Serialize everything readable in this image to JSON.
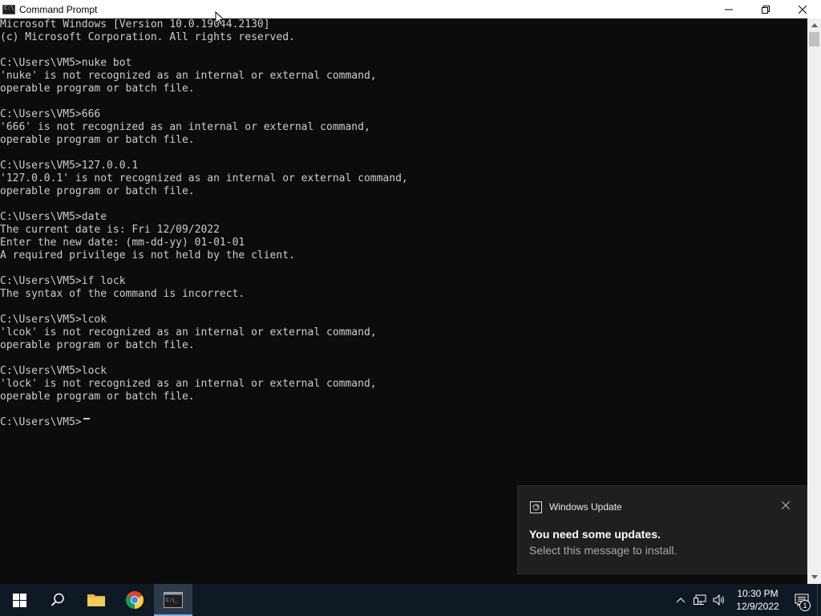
{
  "window": {
    "title": "Command Prompt",
    "controls": {
      "minimize": "minimize",
      "restore": "restore",
      "close": "close"
    }
  },
  "console": {
    "lines": [
      "Microsoft Windows [Version 10.0.19044.2130]",
      "(c) Microsoft Corporation. All rights reserved.",
      "",
      "C:\\Users\\VM5>nuke bot",
      "'nuke' is not recognized as an internal or external command,",
      "operable program or batch file.",
      "",
      "C:\\Users\\VM5>666",
      "'666' is not recognized as an internal or external command,",
      "operable program or batch file.",
      "",
      "C:\\Users\\VM5>127.0.0.1",
      "'127.0.0.1' is not recognized as an internal or external command,",
      "operable program or batch file.",
      "",
      "C:\\Users\\VM5>date",
      "The current date is: Fri 12/09/2022",
      "Enter the new date: (mm-dd-yy) 01-01-01",
      "A required privilege is not held by the client.",
      "",
      "C:\\Users\\VM5>if lock",
      "The syntax of the command is incorrect.",
      "",
      "C:\\Users\\VM5>lcok",
      "'lcok' is not recognized as an internal or external command,",
      "operable program or batch file.",
      "",
      "C:\\Users\\VM5>lock",
      "'lock' is not recognized as an internal or external command,",
      "operable program or batch file.",
      "",
      "C:\\Users\\VM5>"
    ],
    "text_color": "#cccccc",
    "background": "#0c0c0c"
  },
  "toast": {
    "app_name": "Windows Update",
    "title": "You need some updates.",
    "body": "Select this message to install.",
    "icon": "windows-update-icon"
  },
  "taskbar": {
    "pinned": [
      {
        "name": "search",
        "icon": "search-icon"
      },
      {
        "name": "file-explorer",
        "icon": "folder-icon"
      },
      {
        "name": "chrome",
        "icon": "chrome-icon"
      },
      {
        "name": "command-prompt",
        "icon": "cmd-icon",
        "active": true
      }
    ],
    "clock": {
      "time": "10:30 PM",
      "date": "12/9/2022"
    },
    "notification_count": "1"
  }
}
